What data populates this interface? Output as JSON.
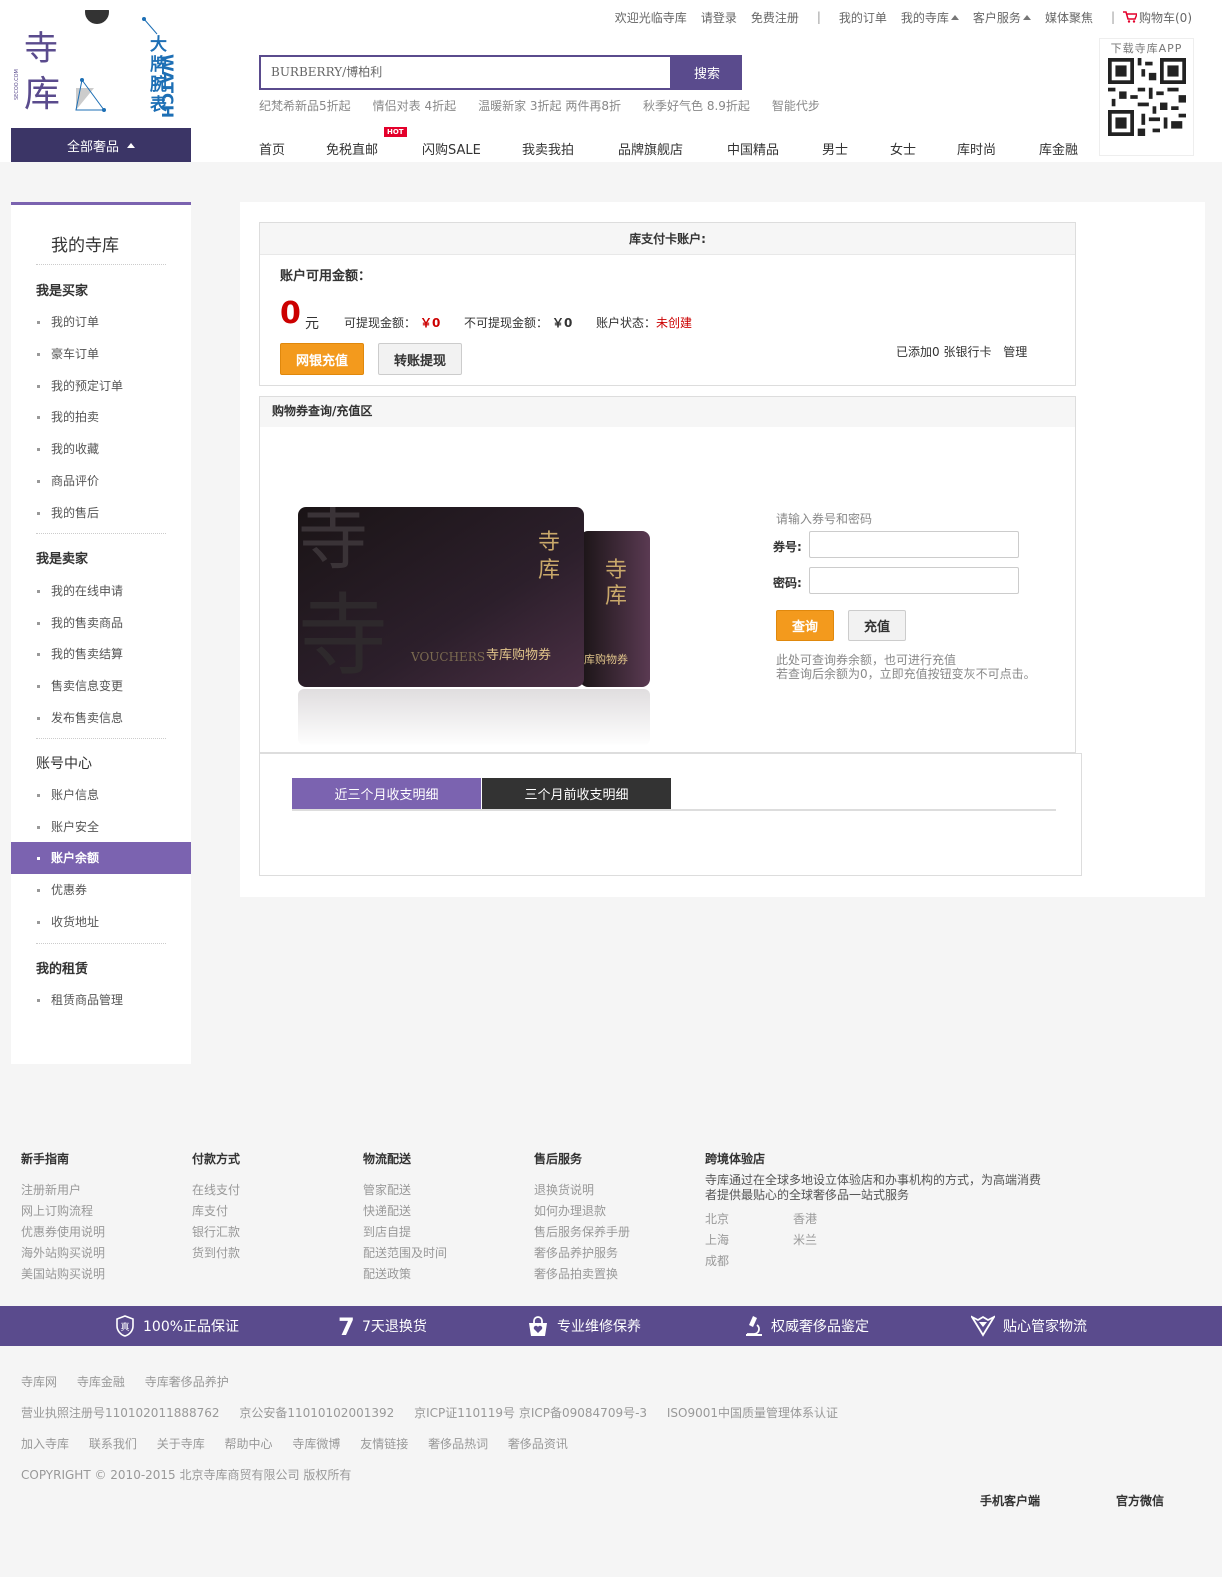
{
  "topbar": {
    "welcome": "欢迎光临寺库",
    "login": "请登录",
    "register": "免费注册",
    "my_orders": "我的订单",
    "my_secoo": "我的寺库",
    "customer_service": "客户服务",
    "media": "媒体聚焦",
    "cart": "购物车(0)"
  },
  "logo": {
    "brand_text": "寺库",
    "site": "SECOO.COM",
    "sub_watch": "WATCH",
    "sub_cn": "大牌腕表"
  },
  "all_categories": "全部奢品",
  "search": {
    "value": "BURBERRY/博柏利",
    "button": "搜索"
  },
  "hot_keywords": [
    "纪梵希新品5折起",
    "情侣对表 4折起",
    "温暖新家 3折起 两件再8折",
    "秋季好气色 8.9折起",
    "智能代步"
  ],
  "nav": [
    "首页",
    "免税直邮",
    "闪购SALE",
    "我卖我拍",
    "品牌旗舰店",
    "中国精品",
    "男士",
    "女士",
    "库时尚",
    "库金融"
  ],
  "nav_hot_badge": "HOT",
  "qr": {
    "label": "下载寺库APP"
  },
  "sidebar": {
    "title": "我的寺库",
    "groups": [
      {
        "label": "我是买家",
        "items": [
          "我的订单",
          "豪车订单",
          "我的预定订单",
          "我的拍卖",
          "我的收藏",
          "商品评价",
          "我的售后"
        ]
      },
      {
        "label": "我是卖家",
        "items": [
          "我的在线申请",
          "我的售卖商品",
          "我的售卖结算",
          "售卖信息变更",
          "发布售卖信息"
        ]
      },
      {
        "label": "账号中心",
        "items": [
          "账户信息",
          "账户安全",
          "账户余额",
          "优惠券",
          "收货地址"
        ]
      },
      {
        "label": "我的租赁",
        "items": [
          "租赁商品管理"
        ]
      }
    ],
    "active_item": "账户余额"
  },
  "account": {
    "header": "库支付卡账户:",
    "available_label": "账户可用金额：",
    "balance": "0",
    "unit": "元",
    "withdrawable_label": "可提现金额：",
    "withdrawable_value": "￥0",
    "non_withdrawable_label": "不可提现金额：",
    "non_withdrawable_value": "￥0",
    "status_label": "账户状态：",
    "status_value": "未创建",
    "recharge_button": "网银充值",
    "withdraw_button": "转账提现",
    "cards_added": "已添加0 张银行卡",
    "manage": "管理"
  },
  "voucher": {
    "header": "购物券查询/充值区",
    "card_text_en": "VOUCHERS",
    "card_text_cn": "寺库购物券",
    "card_text_cn_small": "库购物券",
    "hint": "请输入券号和密码",
    "code_label": "券号:",
    "password_label": "密码:",
    "query_button": "查询",
    "topup_button": "充值",
    "note_line1": "此处可查询券余额，也可进行充值",
    "note_line2": "若查询后余额为0，立即充值按钮变灰不可点击。"
  },
  "detail_tabs": [
    "近三个月收支明细",
    "三个月前收支明细"
  ],
  "footer": {
    "columns": [
      {
        "title": "新手指南",
        "items": [
          "注册新用户",
          "网上订购流程",
          "优惠券使用说明",
          "海外站购买说明",
          "美国站购买说明"
        ]
      },
      {
        "title": "付款方式",
        "items": [
          "在线支付",
          "库支付",
          "银行汇款",
          "货到付款"
        ]
      },
      {
        "title": "物流配送",
        "items": [
          "管家配送",
          "快递配送",
          "到店自提",
          "配送范围及时间",
          "配送政策"
        ]
      },
      {
        "title": "售后服务",
        "items": [
          "退换货说明",
          "如何办理退款",
          "售后服务保养手册",
          "奢侈品养护服务",
          "奢侈品拍卖置换"
        ]
      }
    ],
    "experience": {
      "title": "跨境体验店",
      "desc1": "寺库通过在全球多地设立体验店和办事机构的方式，为高端消费",
      "desc2": "者提供最贴心的全球奢侈品一站式服务",
      "cities": [
        "北京",
        "香港",
        "上海",
        "米兰",
        "成都"
      ]
    },
    "guarantees": [
      "100%正品保证",
      "7天退换货",
      "专业维修保养",
      "权威奢侈品鉴定",
      "贴心管家物流"
    ],
    "guarantee_icon_text": [
      "真",
      "7"
    ],
    "row1": [
      "寺库网",
      "寺库金融",
      "寺库奢侈品养护"
    ],
    "row2": [
      "营业执照注册号110102011888762",
      "京公安备11010102001392",
      "京ICP证110119号 京ICP备09084709号-3",
      "ISO9001中国质量管理体系认证"
    ],
    "row3": [
      "加入寺库",
      "联系我们",
      "关于寺库",
      "帮助中心",
      "寺库微博",
      "友情链接",
      "奢侈品热词",
      "奢侈品资讯"
    ],
    "copyright": "COPYRIGHT © 2010-2015 北京寺库商贸有限公司 版权所有",
    "mobile_client": "手机客户端",
    "official_wechat": "官方微信"
  },
  "colors": {
    "brand_purple": "#5a4b8d",
    "sidebar_active": "#7b63b0",
    "orange_button": "#f39a1d",
    "price_red": "#c00"
  }
}
